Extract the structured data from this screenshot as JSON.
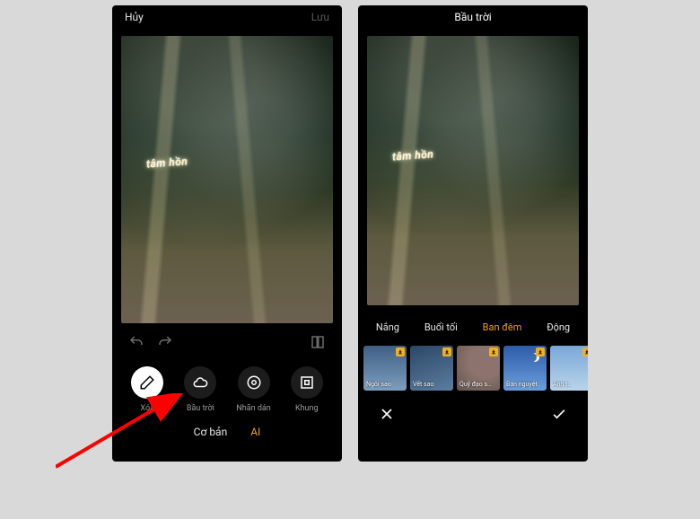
{
  "left": {
    "cancel_label": "Hủy",
    "save_label": "Lưu",
    "signboard_text": "tâm hồn",
    "tools": [
      {
        "label": "Xóa",
        "icon": "eraser",
        "active": true
      },
      {
        "label": "Bầu trời",
        "icon": "cloud",
        "active": false
      },
      {
        "label": "Nhãn dán",
        "icon": "sticker",
        "active": false
      },
      {
        "label": "Khung",
        "icon": "frame",
        "active": false
      }
    ],
    "modes": [
      {
        "label": "Cơ bản",
        "active": false
      },
      {
        "label": "AI",
        "active": true
      }
    ]
  },
  "right": {
    "title": "Bầu trời",
    "signboard_text": "tâm hồn",
    "cats": [
      {
        "label": "Nắng",
        "active": false
      },
      {
        "label": "Buổi tối",
        "active": false
      },
      {
        "label": "Ban đêm",
        "active": true
      },
      {
        "label": "Động",
        "active": false
      }
    ],
    "presets": [
      {
        "label": "Ngôi sao",
        "bg": "bg-stars",
        "dl": true
      },
      {
        "label": "Vết sao",
        "bg": "bg-trail",
        "dl": true
      },
      {
        "label": "Quỹ đạo s…",
        "bg": "bg-orbit",
        "dl": true
      },
      {
        "label": "Bán nguyệt",
        "bg": "bg-moon",
        "dl": true
      },
      {
        "label": "Ánh t…",
        "bg": "bg-clouds",
        "dl": true
      }
    ]
  }
}
